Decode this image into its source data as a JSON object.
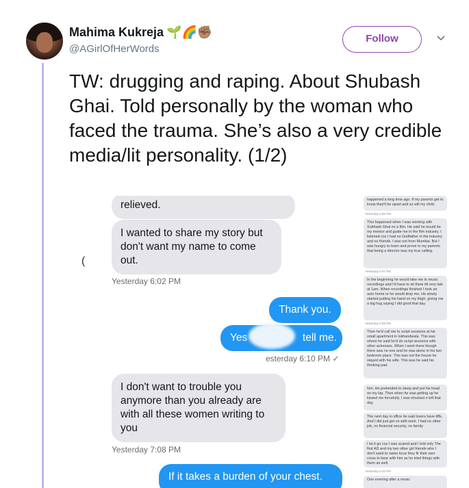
{
  "author": {
    "name": "Mahima Kukreja",
    "emoji": "🌱🌈✊🏽",
    "handle": "@AGirlOfHerWords"
  },
  "follow_label": "Follow",
  "tweet_text": "TW: drugging and raping. About Shubash Ghai. Told personally by the woman who faced the trauma. She’s also a very credible media/lit personality. (1/2)",
  "chat": {
    "bubble1": "relieved.",
    "bubble2": "I wanted to share my story but don't want my name to come out.",
    "bracket": "(",
    "stamp1": "Yesterday 6:02 PM",
    "out1": "Thank you.",
    "out2_prefix": "Yes",
    "out2_suffix": "tell me.",
    "stamp2": "esterday 6:10 PM ✓",
    "bubble3": "I don't want to trouble you anymore than you already are with all these women writing to you",
    "stamp3": "Yesterday 7:08 PM",
    "out3": "If it takes a burden of your chest."
  },
  "side": {
    "messages": [
      "happened a long time ago. If my parents get to know they'll be upset and so will my child.",
      "This happened when I was working with Subhash Ghai on a film. He said he would be my mentor and guide me in the film industry. I listened coz I had no Godfather in the industry and no friends. I was not from Mumbai. But I was hungry to learn and prove to my parents that being a director was my true calling.",
      "In the beginning he would take me to music recordings and I'd have to sit there till very late at 1am. When recordings finished I took an auto home or he would drop me. He slowly started putting his hand on my thigh, giving me a big hug saying I did good that day.",
      "Then he'd call me to script sessions at his small apartment in lokhandwala. This was where he said he'd do script sessions with other actresses. When I went there though there was no one and he was alone in his two bedroom place. This was not the house he stayed with his wife. This was he said his thinking pad.",
      "him. He pretended to sleep and put his head on my lap. Then when he was getting up he kissed me forcefully. I was shocked n left that day.",
      "The next day in office he said lovers have tiffs. And I did just get on with work. I had no other job, no financial security, no family.",
      "I let it go coz I was scared and I told only The first AD and my two other girl friends who I don't want to name bcoz they fir their own cross to bear with him as he tried things with them as well.",
      "One evening after a music"
    ],
    "stamps": [
      "Yesterday 6:06 PM",
      "Yesterday 6:07 PM",
      "Yesterday 6:08 PM",
      "Yesterday 6:09 PM",
      "Yesterday 6:20 PM"
    ]
  },
  "colors": {
    "follow": "#8e44ad",
    "thread_line": "#c4b5e8",
    "outgoing_bubble": "#2196f3",
    "incoming_bubble": "#e5e5ea"
  }
}
